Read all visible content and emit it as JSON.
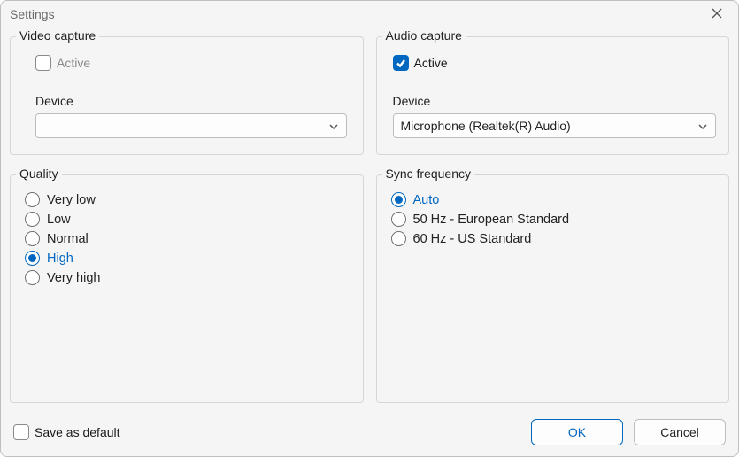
{
  "window": {
    "title": "Settings"
  },
  "video": {
    "legend": "Video capture",
    "active_label": "Active",
    "active_checked": false,
    "device_label": "Device",
    "device_value": ""
  },
  "audio": {
    "legend": "Audio capture",
    "active_label": "Active",
    "active_checked": true,
    "device_label": "Device",
    "device_value": "Microphone (Realtek(R) Audio)"
  },
  "quality": {
    "legend": "Quality",
    "selected": "High",
    "options": [
      "Very low",
      "Low",
      "Normal",
      "High",
      "Very high"
    ]
  },
  "sync": {
    "legend": "Sync frequency",
    "selected": "Auto",
    "options": [
      "Auto",
      "50 Hz - European Standard",
      "60 Hz - US Standard"
    ]
  },
  "footer": {
    "save_default_label": "Save as default",
    "save_default_checked": false,
    "ok_label": "OK",
    "cancel_label": "Cancel"
  }
}
